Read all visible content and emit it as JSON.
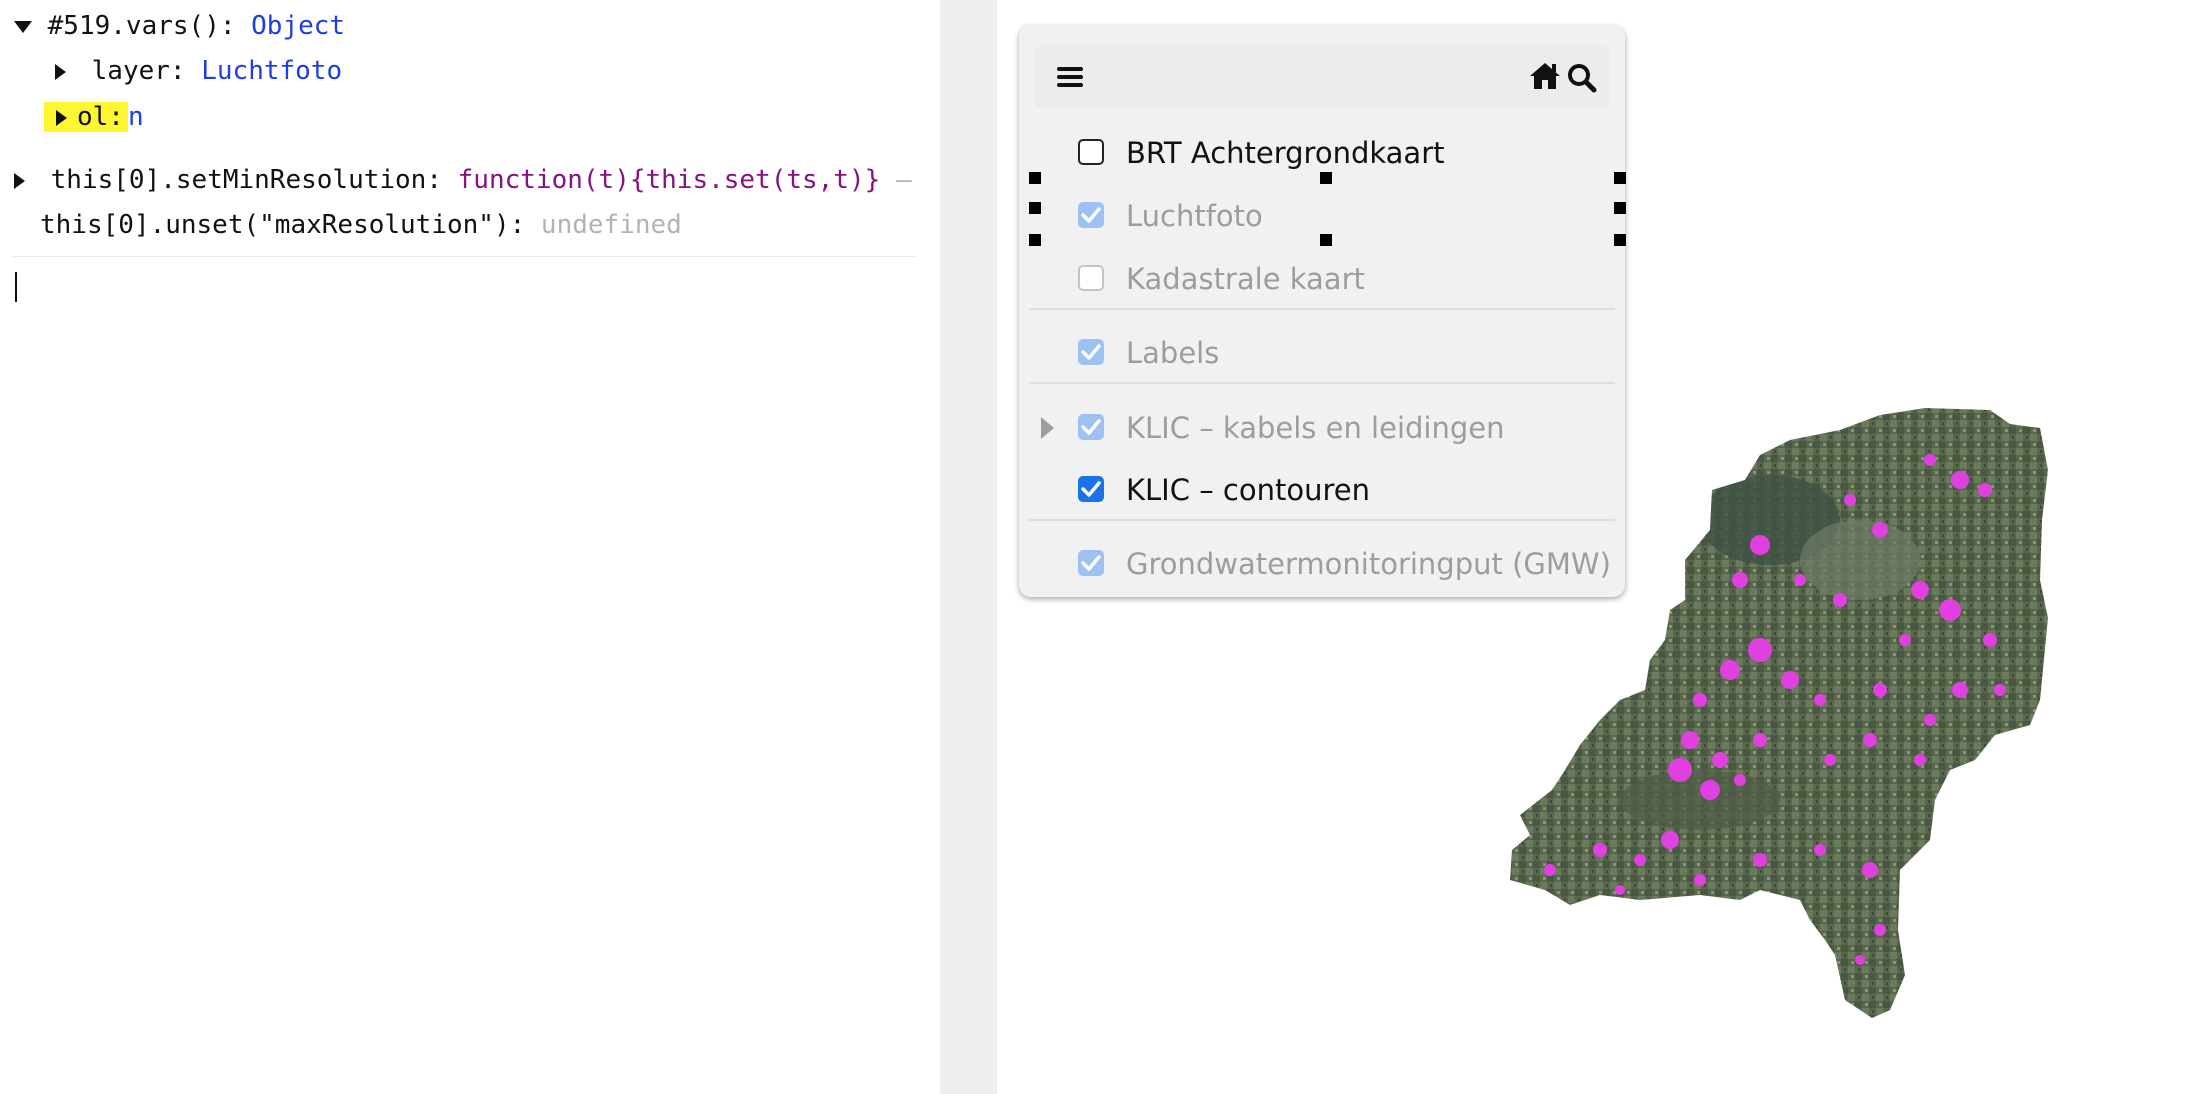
{
  "console": {
    "line1": {
      "expr": "#519.vars():",
      "value": "Object"
    },
    "line2": {
      "key": "layer:",
      "value": "Luchtfoto"
    },
    "line3": {
      "key": "ol:",
      "value": "n"
    },
    "line4": {
      "expr": "this[0].setMinResolution:",
      "value": "function(t){this.set(ts,t)}",
      "trail": "–"
    },
    "line5": {
      "expr": "this[0].unset(\"maxResolution\"):",
      "value": "undefined"
    }
  },
  "layer_switcher": {
    "menu_icon": "hamburger-menu-icon",
    "home_icon": "home-icon",
    "search_icon": "search-icon",
    "layers": [
      {
        "label": "BRT Achtergrondkaart",
        "checked": false,
        "enabled": true
      },
      {
        "label": "Luchtfoto",
        "checked": true,
        "enabled": false
      },
      {
        "label": "Kadastrale kaart",
        "checked": false,
        "enabled": false
      },
      {
        "label": "Labels",
        "checked": true,
        "enabled": false
      },
      {
        "label": "KLIC – kabels en leidingen",
        "checked": true,
        "enabled": false,
        "expandable": true
      },
      {
        "label": "KLIC – contouren",
        "checked": true,
        "enabled": true
      },
      {
        "label": "Grondwatermonitoringput (GMW)",
        "checked": true,
        "enabled": false
      }
    ]
  },
  "colors": {
    "accent": "#1a73e8",
    "highlight": "#fdf631",
    "overlay": "#e040e0",
    "aerial": "#5a6a50"
  }
}
